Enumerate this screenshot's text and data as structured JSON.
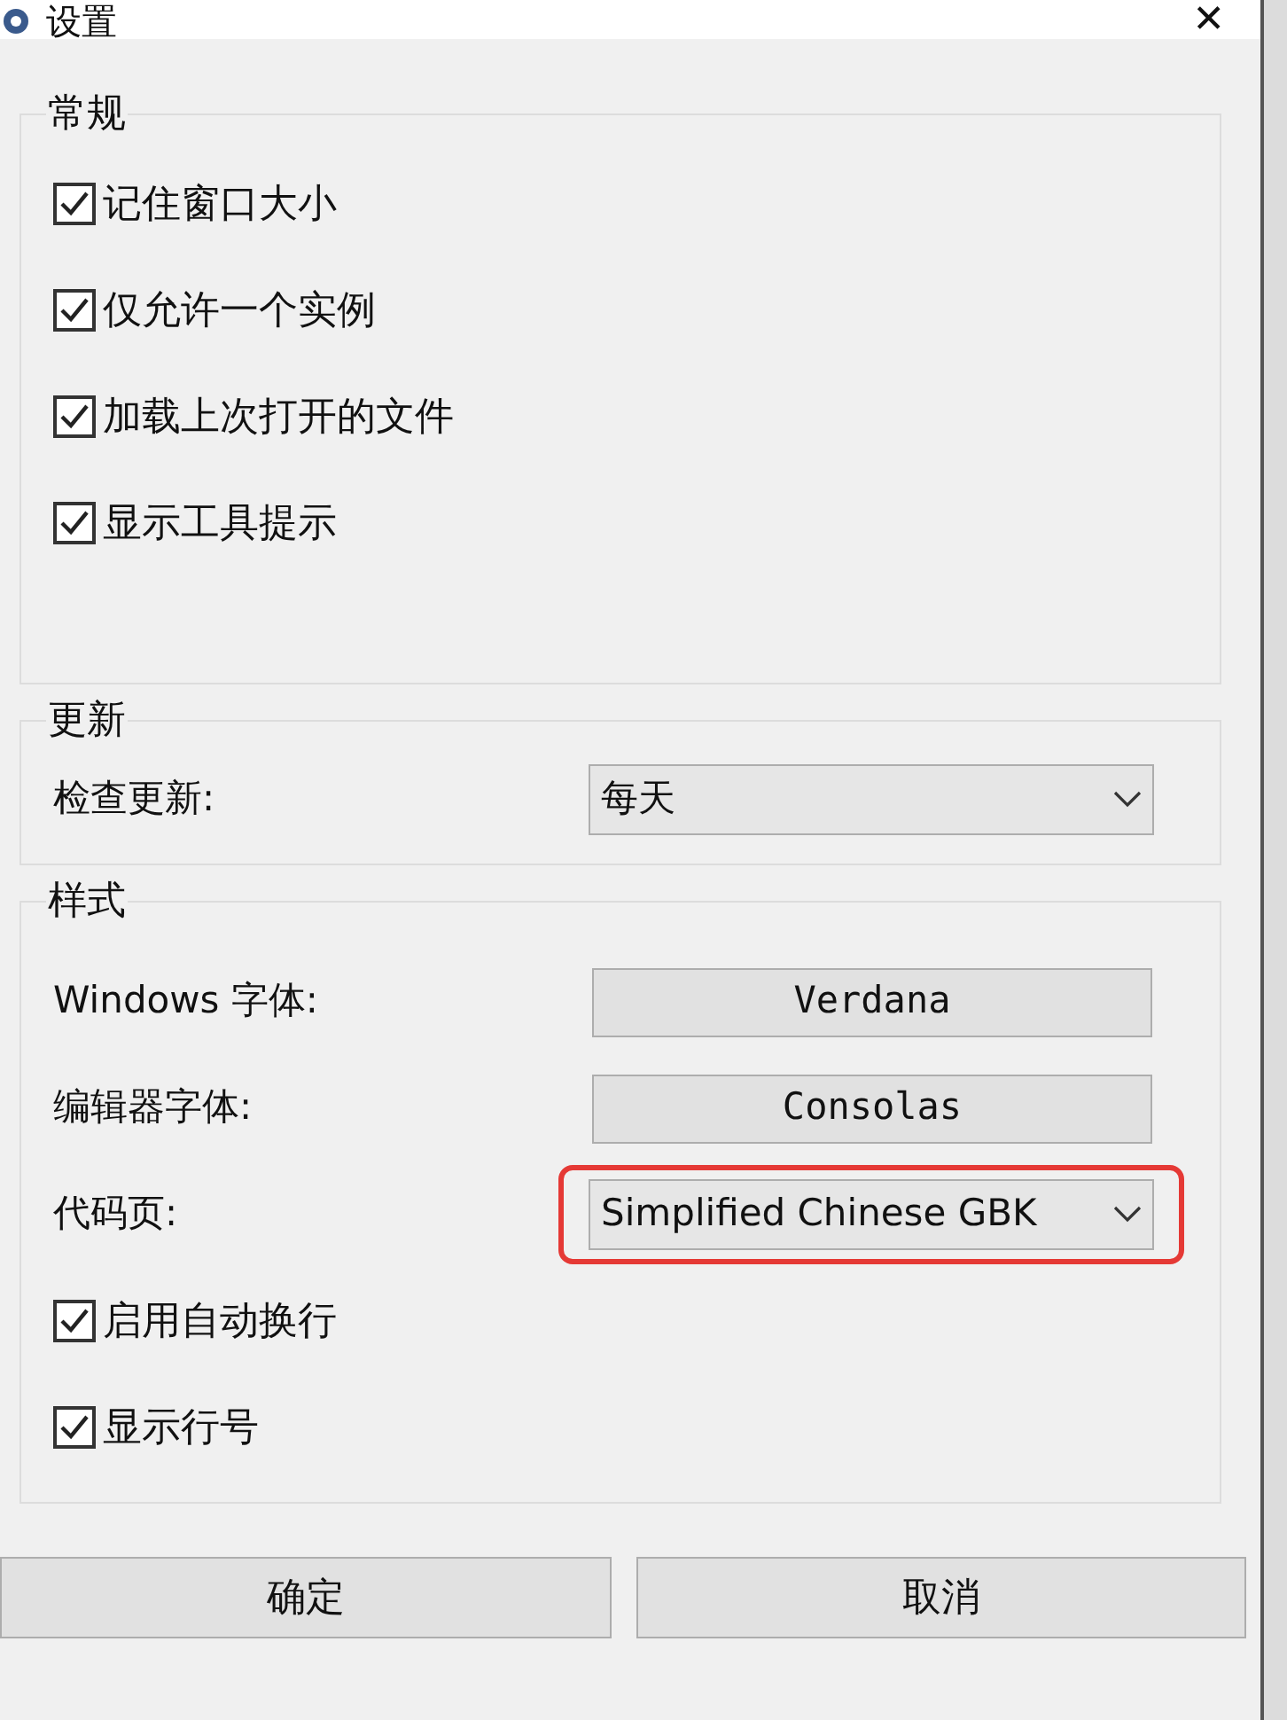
{
  "window": {
    "title": "设置",
    "close": "✕"
  },
  "groups": [
    {
      "title": "常规",
      "items": [
        {
          "kind": "checkbox",
          "label": "记住窗口大小",
          "checked": true
        },
        {
          "kind": "checkbox",
          "label": "仅允许一个实例",
          "checked": true
        },
        {
          "kind": "checkbox",
          "label": "加载上次打开的文件",
          "checked": true
        },
        {
          "kind": "checkbox",
          "label": "显示工具提示",
          "checked": true
        }
      ]
    },
    {
      "title": "更新",
      "items": [
        {
          "kind": "select",
          "label": "检查更新:",
          "value": "每天",
          "highlighted": false
        }
      ]
    },
    {
      "title": "样式",
      "items": [
        {
          "kind": "button",
          "label": "Windows 字体:",
          "value": "Verdana"
        },
        {
          "kind": "button",
          "label": "编辑器字体:",
          "value": "Consolas"
        },
        {
          "kind": "select",
          "label": "代码页:",
          "value": "Simplified Chinese GBK",
          "highlighted": true
        },
        {
          "kind": "checkbox",
          "label": "启用自动换行",
          "checked": true
        },
        {
          "kind": "checkbox",
          "label": "显示行号",
          "checked": true
        }
      ]
    }
  ],
  "buttons": [
    "确定",
    "取消"
  ]
}
